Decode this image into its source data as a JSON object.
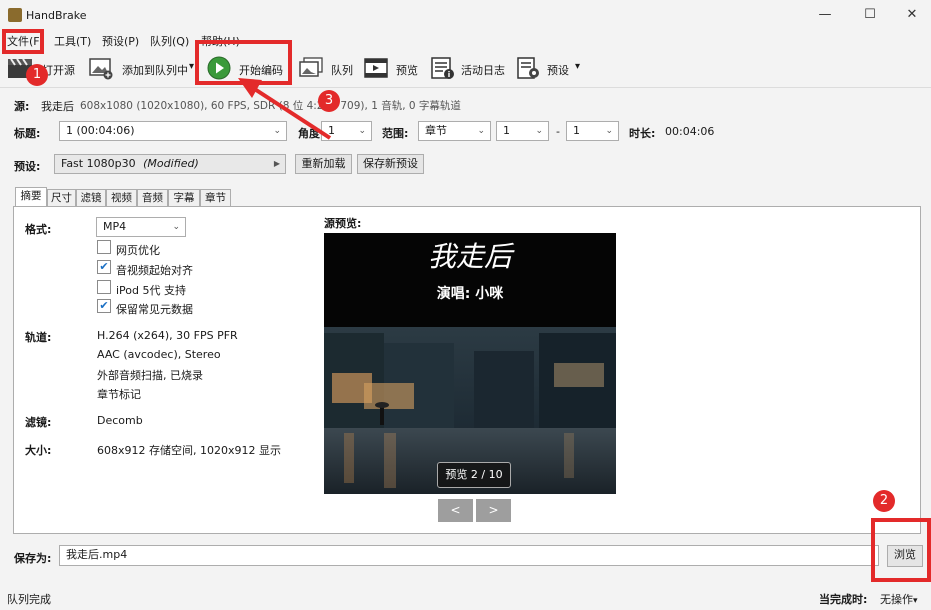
{
  "window": {
    "title": "HandBrake"
  },
  "window_buttons": {
    "minimize": "—",
    "maximize": "☐",
    "close": "✕"
  },
  "menu": [
    "文件(F)",
    "工具(T)",
    "预设(P)",
    "队列(Q)",
    "帮助(H)"
  ],
  "toolbar": {
    "open_source": "打开源",
    "add_to_queue": "添加到队列中",
    "add_dropdown": "▾",
    "start_encode": "开始编码",
    "queue": "队列",
    "preview": "预览",
    "activity_log": "活动日志",
    "presets": "预设",
    "presets_dropdown": "▾"
  },
  "source": {
    "label": "源:",
    "name": "我走后",
    "info": "608x1080 (1020x1080), 60 FPS, SDR (8 位 4:2:0, 709), 1 音轨, 0 字幕轨道"
  },
  "title_row": {
    "title_label": "标题:",
    "title_value": "1 (00:04:06)",
    "angle_label": "角度:",
    "angle_value": "1",
    "range_label": "范围:",
    "range_type": "章节",
    "range_start": "1",
    "range_sep": "-",
    "range_end": "1",
    "duration_label": "时长:",
    "duration_value": "00:04:06"
  },
  "preset_row": {
    "label": "预设:",
    "value": "Fast 1080p30",
    "modified": "(Modified)",
    "reload": "重新加载",
    "save_new": "保存新预设"
  },
  "tabs": [
    "摘要",
    "尺寸",
    "滤镜",
    "视频",
    "音频",
    "字幕",
    "章节"
  ],
  "summary": {
    "format_label": "格式:",
    "format_value": "MP4",
    "options": [
      {
        "label": "网页优化",
        "checked": false
      },
      {
        "label": "音视频起始对齐",
        "checked": true
      },
      {
        "label": "iPod 5代 支持",
        "checked": false
      },
      {
        "label": "保留常见元数据",
        "checked": true
      }
    ],
    "tracks_label": "轨道:",
    "tracks": [
      "H.264 (x264), 30 FPS PFR",
      "AAC (avcodec), Stereo",
      "外部音频扫描, 已烧录",
      "章节标记"
    ],
    "filters_label": "滤镜:",
    "filters_value": "Decomb",
    "size_label": "大小:",
    "size_value": "608x912 存储空间, 1020x912 显示"
  },
  "preview": {
    "label": "源预览:",
    "song_title": "我走后",
    "singer": "演唱: 小咪",
    "counter": "预览 2 / 10",
    "prev": "<",
    "next": ">"
  },
  "save": {
    "label": "保存为:",
    "value": "我走后.mp4",
    "browse": "浏览"
  },
  "status": {
    "left": "队列完成",
    "when_done_label": "当完成时:",
    "when_done_value": "无操作"
  },
  "annotations": [
    "1",
    "2",
    "3"
  ],
  "colors": {
    "annotation_red": "#e32a2a",
    "play_green": "#3a9a3a"
  }
}
